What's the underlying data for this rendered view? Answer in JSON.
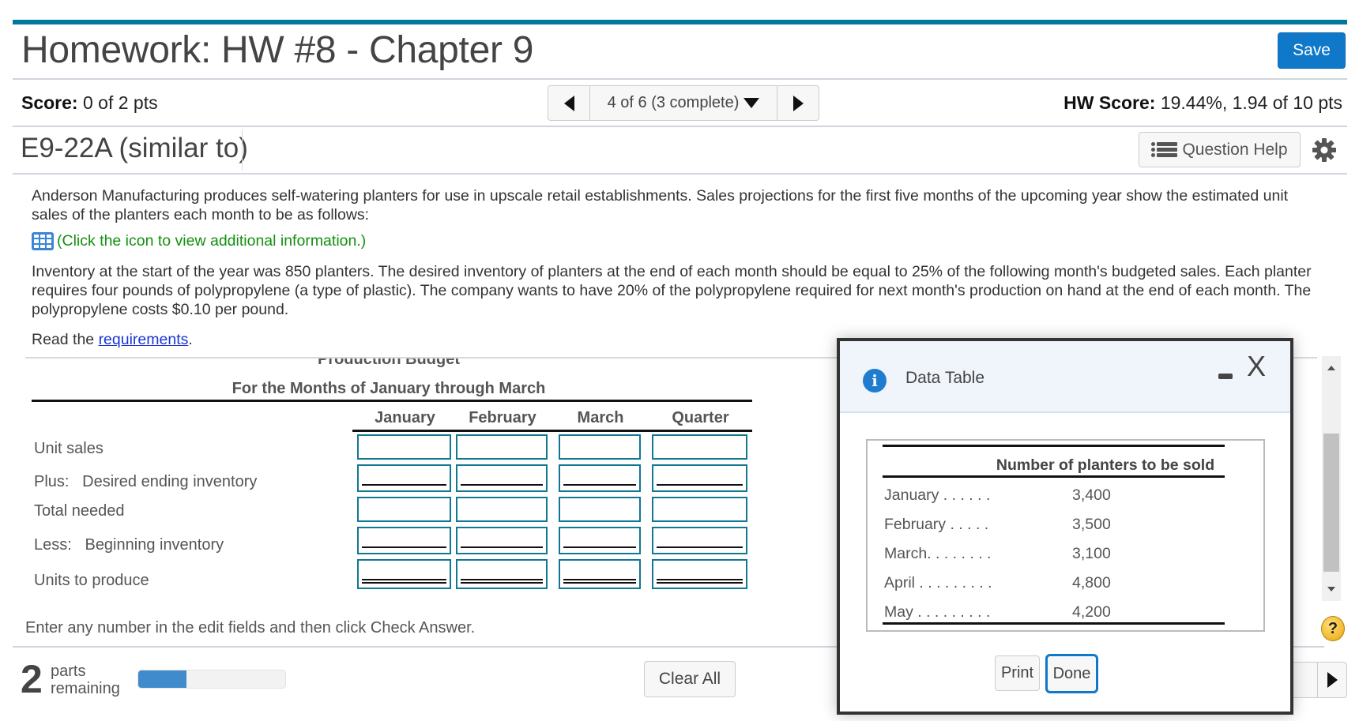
{
  "header": {
    "title": "Homework: HW #8 - Chapter 9",
    "save_label": "Save",
    "accent_color": "#00789a"
  },
  "score_row": {
    "score_label": "Score:",
    "score_value": "0 of 2 pts",
    "nav_label": "4 of 6 (3 complete)",
    "hw_score_label": "HW Score:",
    "hw_score_value": "19.44%, 1.94 of 10 pts"
  },
  "question": {
    "id": "E9-22A (similar to)",
    "help_label": "Question Help",
    "paragraph1": "Anderson Manufacturing produces self-watering planters for use in upscale retail establishments. Sales projections for the first five months of the upcoming year show the estimated unit sales of the planters each month to be as follows:",
    "info_link": "(Click the icon to view additional information.)",
    "paragraph2": "Inventory at the start of the year was 850 planters. The desired inventory of planters at the end of each month should be equal to 25% of the following month's budgeted sales. Each planter requires four pounds of polypropylene (a type of plastic). The company wants to have 20% of the polypropylene required for next month's production on hand at the end of each month. The polypropylene costs $0.10 per pound.",
    "read_prefix": "Read the ",
    "read_link": "requirements",
    "read_suffix": "."
  },
  "budget": {
    "title": "Production Budget",
    "subtitle": "For the Months of January through March",
    "columns": [
      "January",
      "February",
      "March",
      "Quarter"
    ],
    "rows": [
      {
        "label": "Unit sales",
        "values": [
          "",
          "",
          "",
          ""
        ],
        "underline": "none"
      },
      {
        "label": "Plus:   Desired ending inventory",
        "values": [
          "",
          "",
          "",
          ""
        ],
        "underline": "single"
      },
      {
        "label": "Total needed",
        "values": [
          "",
          "",
          "",
          ""
        ],
        "underline": "none"
      },
      {
        "label": "Less:   Beginning inventory",
        "values": [
          "",
          "",
          "",
          ""
        ],
        "underline": "single"
      },
      {
        "label": "Units to produce",
        "values": [
          "",
          "",
          "",
          ""
        ],
        "underline": "double"
      }
    ]
  },
  "footer": {
    "instruction": "Enter any number in the edit fields and then click Check Answer.",
    "parts_count": "2",
    "parts_label_1": "parts",
    "parts_label_2": "remaining",
    "progress_fraction": 0.33,
    "clear_all_label": "Clear All",
    "help_symbol": "?"
  },
  "dialog": {
    "title": "Data Table",
    "info_symbol": "i",
    "close_symbol": "X",
    "table_header": "Number of planters to be sold",
    "rows": [
      {
        "month": "January . . . . . .",
        "value": "3,400"
      },
      {
        "month": "February . . . . .",
        "value": "3,500"
      },
      {
        "month": "March. . . . . . . .",
        "value": "3,100"
      },
      {
        "month": "April . . . . . . . . .",
        "value": "4,800"
      },
      {
        "month": "May . . . . . . . . .",
        "value": "4,200"
      }
    ],
    "print_label": "Print",
    "done_label": "Done"
  }
}
